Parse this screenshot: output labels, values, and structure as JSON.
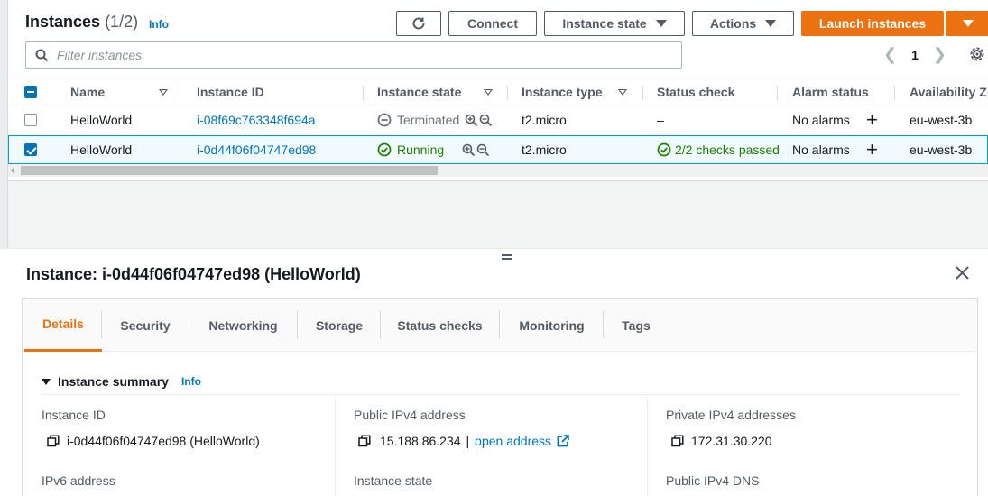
{
  "header": {
    "title": "Instances",
    "count": "(1/2)",
    "info": "Info"
  },
  "toolbar": {
    "connect": "Connect",
    "instance_state": "Instance state",
    "actions": "Actions",
    "launch": "Launch instances"
  },
  "filter": {
    "placeholder": "Filter instances"
  },
  "pagination": {
    "page": "1"
  },
  "table": {
    "columns": [
      "Name",
      "Instance ID",
      "Instance state",
      "Instance type",
      "Status check",
      "Alarm status",
      "Availability Z"
    ],
    "rows": [
      {
        "name": "HelloWorld",
        "instance_id": "i-08f69c763348f694a",
        "state": "Terminated",
        "type": "t2.micro",
        "status_check": "–",
        "alarm": "No alarms",
        "az": "eu-west-3b",
        "selected": false
      },
      {
        "name": "HelloWorld",
        "instance_id": "i-0d44f06f04747ed98",
        "state": "Running",
        "type": "t2.micro",
        "status_check": "2/2 checks passed",
        "alarm": "No alarms",
        "az": "eu-west-3b",
        "selected": true
      }
    ]
  },
  "detail": {
    "title": "Instance: i-0d44f06f04747ed98 (HelloWorld)",
    "tabs": [
      "Details",
      "Security",
      "Networking",
      "Storage",
      "Status checks",
      "Monitoring",
      "Tags"
    ],
    "active_tab": "Details",
    "summary_title": "Instance summary",
    "summary_info": "Info",
    "fields": {
      "instance_id_label": "Instance ID",
      "instance_id_value": "i-0d44f06f04747ed98 (HelloWorld)",
      "public_ipv4_label": "Public IPv4 address",
      "public_ipv4_value": "15.188.86.234",
      "public_ipv4_sep": "|",
      "open_address": "open address",
      "private_ipv4_label": "Private IPv4 addresses",
      "private_ipv4_value": "172.31.30.220",
      "ipv6_label": "IPv6 address",
      "instance_state_label": "Instance state",
      "public_dns_label": "Public IPv4 DNS"
    }
  },
  "colors": {
    "accent_orange": "#ec7211",
    "link_blue": "#0073bb",
    "success_green": "#1d8102",
    "selected_row_bg": "#f1faff"
  }
}
